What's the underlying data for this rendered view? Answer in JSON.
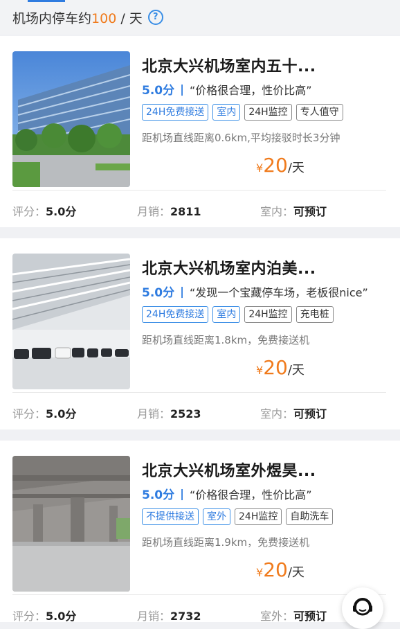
{
  "header": {
    "prefix": "机场内停车约",
    "count": "100",
    "suffix": " / 天",
    "help_glyph": "?",
    "help_icon": "question-circle-icon"
  },
  "listings": [
    {
      "title": "北京大兴机场室内五十...",
      "score": "5.0分",
      "review": "“价格很合理，性价比高”",
      "tags": [
        "24H免费接送",
        "室内",
        "24H监控",
        "专人值守"
      ],
      "distance": "距机场直线距离0.6km,平均接驳时长3分钟",
      "price_symbol": "¥",
      "price": "20",
      "price_unit": "/天",
      "rating_label": "评分：",
      "rating_value": "5.0分",
      "sales_label": "月销：",
      "sales_value": "2811",
      "type_label": "室内：",
      "type_value": "可预订"
    },
    {
      "title": "北京大兴机场室内泊美...",
      "score": "5.0分",
      "review": "“发现一个宝藏停车场，老板很nice”",
      "tags": [
        "24H免费接送",
        "室内",
        "24H监控",
        "充电桩"
      ],
      "distance": "距机场直线距离1.8km，免费接送机",
      "price_symbol": "¥",
      "price": "20",
      "price_unit": "/天",
      "rating_label": "评分：",
      "rating_value": "5.0分",
      "sales_label": "月销：",
      "sales_value": "2523",
      "type_label": "室内：",
      "type_value": "可预订"
    },
    {
      "title": "北京大兴机场室外煜昊...",
      "score": "5.0分",
      "review": "“价格很合理，性价比高”",
      "tags": [
        "不提供接送",
        "室外",
        "24H监控",
        "自助洗车"
      ],
      "distance": "距机场直线距离1.9km，免费接送机",
      "price_symbol": "¥",
      "price": "20",
      "price_unit": "/天",
      "rating_label": "评分：",
      "rating_value": "5.0分",
      "sales_label": "月销：",
      "sales_value": "2732",
      "type_label": "室外：",
      "type_value": "可预订"
    }
  ],
  "colors": {
    "accent": "#2f7ce0",
    "price": "#f07b1d"
  },
  "support_icon": "customer-service-icon"
}
